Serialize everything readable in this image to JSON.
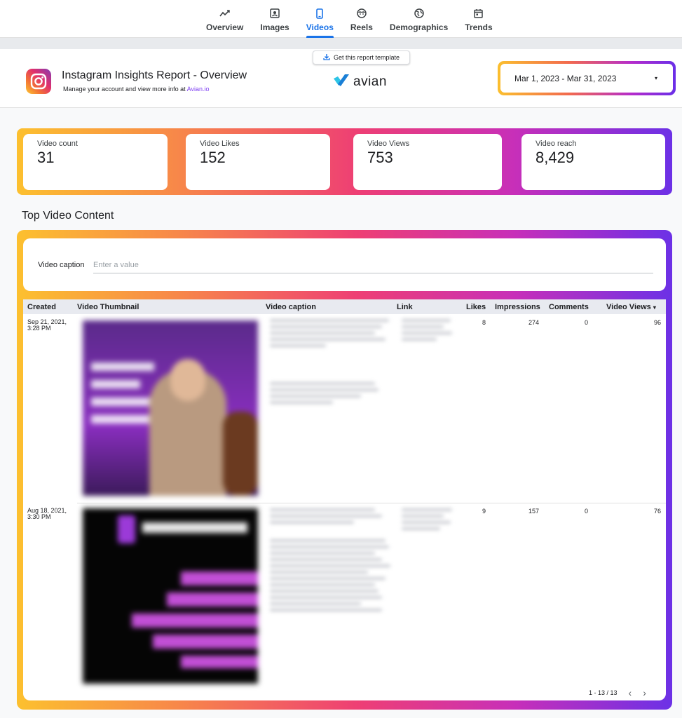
{
  "nav": {
    "tabs": [
      {
        "label": "Overview",
        "icon": "trend-icon"
      },
      {
        "label": "Images",
        "icon": "image-icon"
      },
      {
        "label": "Videos",
        "icon": "phone-icon",
        "active": true
      },
      {
        "label": "Reels",
        "icon": "face-icon"
      },
      {
        "label": "Demographics",
        "icon": "globe-icon"
      },
      {
        "label": "Trends",
        "icon": "calendar-icon"
      }
    ]
  },
  "header": {
    "template_button": "Get this report template",
    "title": "Instagram Insights Report - Overview",
    "subtitle_prefix": "Manage your account and view more info at ",
    "subtitle_link": "Avian.io",
    "brand": "avian",
    "date_range": "Mar 1, 2023 - Mar 31, 2023",
    "date_arrow": "▾"
  },
  "metrics": [
    {
      "label": "Video count",
      "value": "31"
    },
    {
      "label": "Video Likes",
      "value": "152"
    },
    {
      "label": "Video Views",
      "value": "753"
    },
    {
      "label": "Video reach",
      "value": "8,429"
    }
  ],
  "section_title": "Top Video Content",
  "filter": {
    "label": "Video caption",
    "placeholder": "Enter a value"
  },
  "table": {
    "headers": {
      "created": "Created",
      "thumbnail": "Video Thumbnail",
      "caption": "Video caption",
      "link": "Link",
      "likes": "Likes",
      "impressions": "Impressions",
      "comments": "Comments",
      "views": "Video Views",
      "sort_icon": "▾"
    },
    "rows": [
      {
        "created": "Sep 21, 2021, 3:28 PM",
        "likes": "8",
        "impressions": "274",
        "comments": "0",
        "views": "96"
      },
      {
        "created": "Aug 18, 2021, 3:30 PM",
        "likes": "9",
        "impressions": "157",
        "comments": "0",
        "views": "76"
      }
    ]
  },
  "pagination": {
    "range": "1 - 13 / 13",
    "prev": "‹",
    "next": "›"
  },
  "colors": {
    "accent": "#1a73e8",
    "gradient_start": "#fcc02f",
    "gradient_mid": "#ee3f74",
    "gradient_end": "#6c31e6",
    "link": "#7e3ff2"
  }
}
